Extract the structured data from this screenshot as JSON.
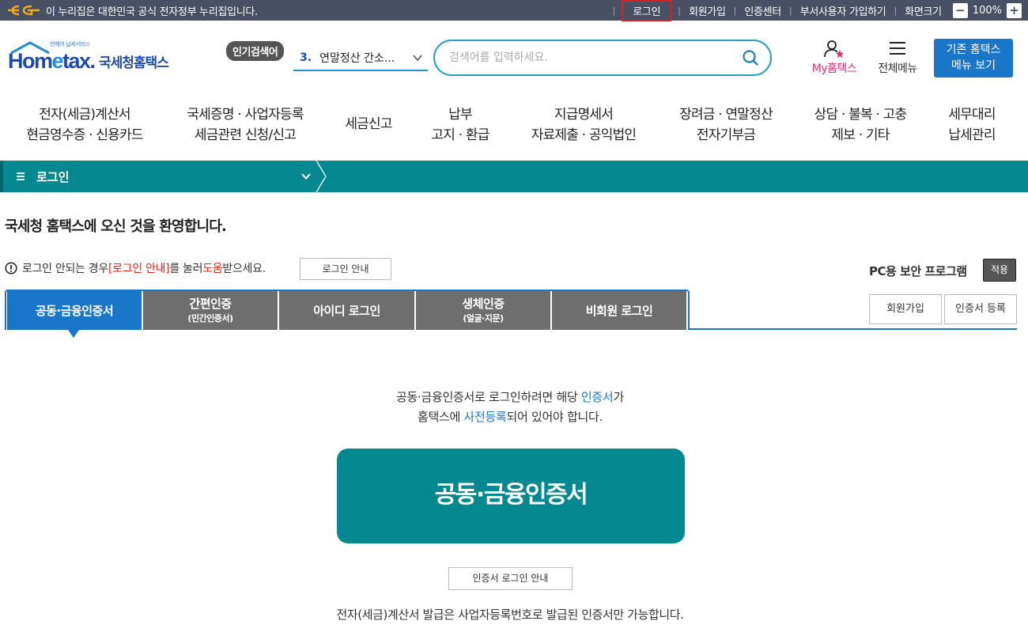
{
  "gov_bar": {
    "logo": "eg-logo",
    "text": "이 누리집은 대한민국 공식 전자정부 누리집입니다.",
    "links": [
      "로그인",
      "회원가입",
      "인증센터",
      "부서사용자 가입하기",
      "화면크기"
    ],
    "zoom": "100%"
  },
  "header": {
    "logo_sub": "언제어 납세서비스",
    "logo_word_a": "Hom",
    "logo_word_e": "e",
    "logo_word_b": "tax.",
    "logo_kor": "국세청홈택스",
    "popular_label": "인기검색어",
    "popular_num": "3.",
    "popular_text": "연말정산 간소...",
    "search_placeholder": "검색어를 입력하세요.",
    "my_hometax": "My홈택스",
    "all_menu": "전체메뉴",
    "old_menu_1": "기존 홈택스",
    "old_menu_2": "메뉴 보기"
  },
  "gnb": [
    {
      "l1": "전자(세금)계산서",
      "l2": "현금영수증 · 신용카드"
    },
    {
      "l1": "국세증명 · 사업자등록",
      "l2": "세금관련 신청/신고"
    },
    {
      "l1": "세금신고",
      "l2": ""
    },
    {
      "l1": "납부",
      "l2": "고지 · 환급"
    },
    {
      "l1": "지급명세서",
      "l2": "자료제출 · 공익법인"
    },
    {
      "l1": "장려금 · 연말정산",
      "l2": "전자기부금"
    },
    {
      "l1": "상담 · 불복 · 고충",
      "l2": "제보 · 기타"
    },
    {
      "l1": "세무대리",
      "l2": "납세관리"
    }
  ],
  "location": {
    "current": "로그인"
  },
  "content": {
    "welcome": "국세청 홈택스에 오신 것을 환영합니다.",
    "notice_a": "로그인 안되는 경우 ",
    "notice_red1": "[로그인 안내]",
    "notice_b": "를 눌러 ",
    "notice_red2": "도움",
    "notice_c": "받으세요.",
    "login_guide_btn": "로그인 안내",
    "pc_security": "PC용 보안 프로그램",
    "apply_btn": "적용",
    "tabs": [
      {
        "t1": "공동·금융인증서",
        "t2": ""
      },
      {
        "t1": "간편인증",
        "t2": "(민간인증서)"
      },
      {
        "t1": "아이디 로그인",
        "t2": ""
      },
      {
        "t1": "생체인증",
        "t2": "(얼굴·지문)"
      },
      {
        "t1": "비회원 로그인",
        "t2": ""
      }
    ],
    "join_btn": "회원가입",
    "cert_reg_btn": "인증서 등록",
    "desc_a": "공동·금융인증서로 로그인하려면 해당 ",
    "desc_blue1": "인증서",
    "desc_b": "가",
    "desc_c": "홈택스에 ",
    "desc_blue2": "사전등록",
    "desc_d": "되어 있어야 합니다.",
    "big_cert_btn": "공동·금융인증서",
    "cert_guide_btn": "인증서 로그인 안내",
    "bottom_note": "전자(세금)계산서 발급은 사업자등록번호로 발급된 인증서만 가능합니다."
  }
}
